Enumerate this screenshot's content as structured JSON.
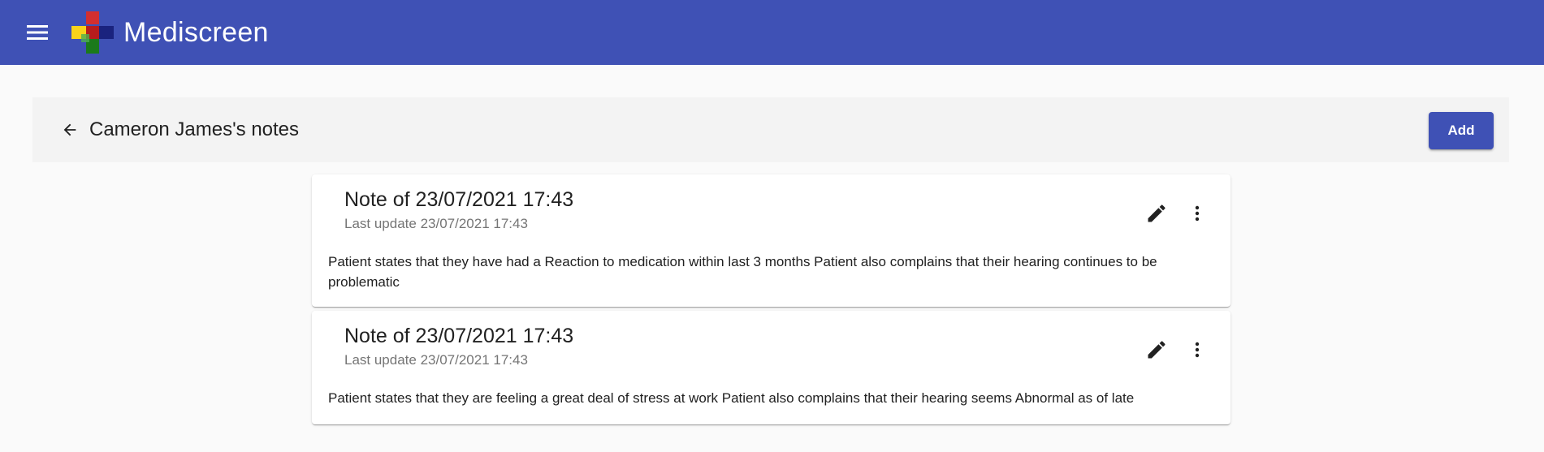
{
  "app": {
    "title": "Mediscreen",
    "colors": {
      "primary": "#3f51b5",
      "background": "#fafafa",
      "header_bar": "#f3f3f3"
    }
  },
  "toolbar": {
    "menu_icon": "menu-icon",
    "logo": "mediscreen-cross-logo"
  },
  "page_header": {
    "back_icon": "arrow-back-icon",
    "title": "Cameron James's notes",
    "add_label": "Add"
  },
  "notes": [
    {
      "title": "Note of 23/07/2021 17:43",
      "subtitle": "Last update 23/07/2021 17:43",
      "content": "Patient states that they have had a Reaction to medication within last 3 months Patient also complains that their hearing continues to be problematic",
      "edit_icon": "pencil-icon",
      "more_icon": "more-vert-icon"
    },
    {
      "title": "Note of 23/07/2021 17:43",
      "subtitle": "Last update 23/07/2021 17:43",
      "content": "Patient states that they are feeling a great deal of stress at work Patient also complains that their hearing seems Abnormal as of late",
      "edit_icon": "pencil-icon",
      "more_icon": "more-vert-icon"
    }
  ]
}
